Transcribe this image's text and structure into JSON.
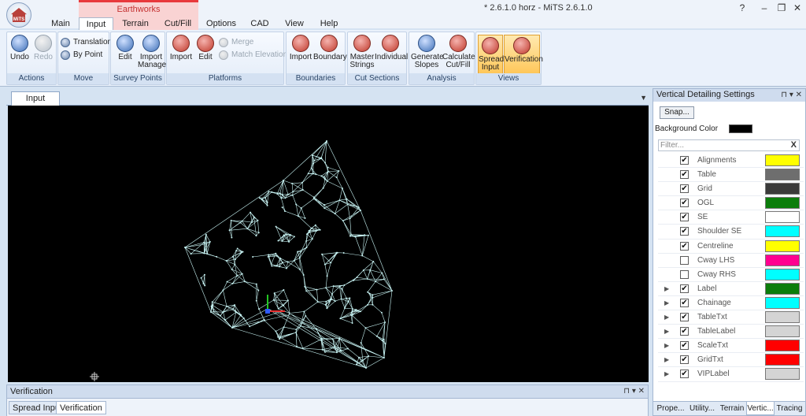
{
  "window": {
    "title": "* 2.6.1.0 horz - MiTS 2.6.1.0",
    "app_logo_text": "MiTS",
    "controls": [
      "?",
      "–",
      "❐",
      "✕"
    ]
  },
  "context_header": "Earthworks",
  "tabs": [
    "Main",
    "Input",
    "Terrain",
    "Cut/Fill",
    "Options",
    "CAD",
    "View",
    "Help"
  ],
  "ribbon": {
    "actions": {
      "label": "Actions",
      "undo": "Undo",
      "redo": "Redo"
    },
    "move": {
      "label": "Move",
      "translation": "Translation",
      "by_point": "By Point"
    },
    "survey_points": {
      "label": "Survey Points",
      "edit": "Edit",
      "import_manage": [
        "Import",
        "Manage"
      ]
    },
    "platforms": {
      "label": "Platforms",
      "import": "Import",
      "edit": "Edit",
      "merge": "Merge",
      "match_elevation": "Match Elevation"
    },
    "boundaries": {
      "label": "Boundaries",
      "import": "Import",
      "boundary": "Boundary"
    },
    "cut_sections": {
      "label": "Cut Sections",
      "master_strings": [
        "Master",
        "Strings"
      ],
      "individual": "Individual"
    },
    "analysis": {
      "label": "Analysis",
      "generate_slopes": [
        "Generate",
        "Slopes"
      ],
      "calculate_cutfill": [
        "Calculate",
        "Cut/Fill"
      ]
    },
    "views": {
      "label": "Views",
      "spread_input": [
        "Spread",
        "Input"
      ],
      "verification": "Verification"
    }
  },
  "document": {
    "tab": "Input",
    "menu_glyph": "▼"
  },
  "bottom_panel": {
    "title": "Verification",
    "controls": "▾ ✕",
    "tabs": [
      "Spread Input",
      "Verification"
    ]
  },
  "right_panel": {
    "title": "Vertical Detailing Settings",
    "controls": "▾ ✕",
    "snap_label": "Snap...",
    "background_label": "Background Color",
    "background_color": "#000000",
    "filter_placeholder": "Filter...",
    "filter_clear": "X",
    "layers": [
      {
        "name": "Alignments",
        "checked": true,
        "color": "#ffff00",
        "expandable": false
      },
      {
        "name": "Table",
        "checked": true,
        "color": "#6e6e6e",
        "expandable": false
      },
      {
        "name": "Grid",
        "checked": true,
        "color": "#3a3a3a",
        "expandable": false
      },
      {
        "name": "OGL",
        "checked": true,
        "color": "#0b7d0b",
        "expandable": false
      },
      {
        "name": "SE",
        "checked": true,
        "color": "#ffffff",
        "expandable": false
      },
      {
        "name": "Shoulder SE",
        "checked": true,
        "color": "#00ffff",
        "expandable": false
      },
      {
        "name": "Centreline",
        "checked": true,
        "color": "#ffff00",
        "expandable": false
      },
      {
        "name": "Cway LHS",
        "checked": false,
        "color": "#ff0090",
        "expandable": false
      },
      {
        "name": "Cway RHS",
        "checked": false,
        "color": "#00ffff",
        "expandable": false
      },
      {
        "name": "Label",
        "checked": true,
        "color": "#0b7d0b",
        "expandable": true
      },
      {
        "name": "Chainage",
        "checked": true,
        "color": "#00ffff",
        "expandable": true
      },
      {
        "name": "TableTxt",
        "checked": true,
        "color": "#d4d4d4",
        "expandable": true
      },
      {
        "name": "TableLabel",
        "checked": true,
        "color": "#d4d4d4",
        "expandable": true
      },
      {
        "name": "ScaleTxt",
        "checked": true,
        "color": "#ff0000",
        "expandable": true
      },
      {
        "name": "GridTxt",
        "checked": true,
        "color": "#ff0000",
        "expandable": true
      },
      {
        "name": "VIPLabel",
        "checked": true,
        "color": "#d4d4d4",
        "expandable": true
      }
    ],
    "tabs": [
      "Prope...",
      "Utility...",
      "Terrain",
      "Vertic...",
      "Tracing"
    ]
  },
  "colors": {
    "accent": "#e8393c",
    "mesh": "#c8f4f4",
    "viewport_bg": "#000000"
  }
}
